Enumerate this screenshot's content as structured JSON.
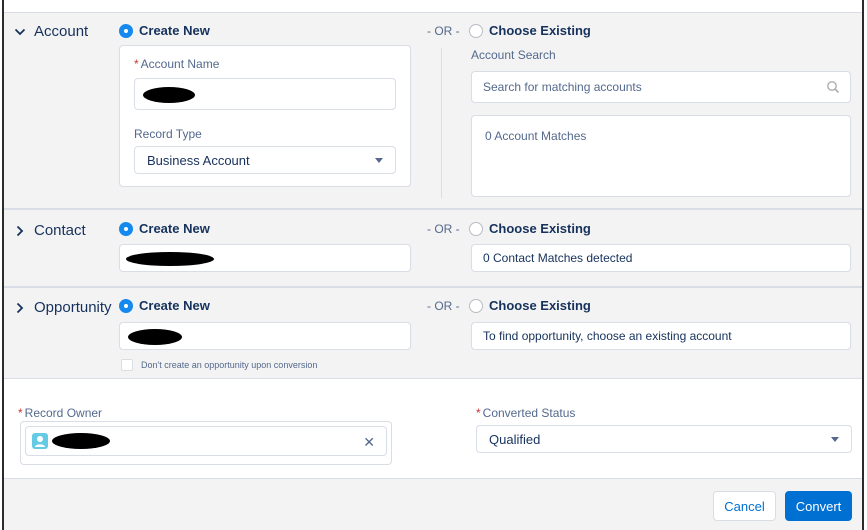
{
  "account": {
    "title": "Account",
    "create_new": "Create New",
    "or": "- OR -",
    "choose_existing": "Choose Existing",
    "account_name_label": "Account Name",
    "record_type_label": "Record Type",
    "record_type_value": "Business Account",
    "search_label": "Account Search",
    "search_placeholder": "Search for matching accounts",
    "matches": "0 Account Matches"
  },
  "contact": {
    "title": "Contact",
    "create_new": "Create New",
    "or": "- OR -",
    "choose_existing": "Choose Existing",
    "matches": "0 Contact Matches detected"
  },
  "opportunity": {
    "title": "Opportunity",
    "create_new": "Create New",
    "or": "- OR -",
    "choose_existing": "Choose Existing",
    "existing_hint": "To find opportunity, choose an existing account",
    "no_opp_checkbox_label": "Don't create an opportunity upon conversion"
  },
  "owner": {
    "record_owner_label": "Record Owner",
    "converted_status_label": "Converted Status",
    "converted_status_value": "Qualified",
    "required_mark": "*"
  },
  "footer": {
    "cancel": "Cancel",
    "convert": "Convert"
  },
  "colors": {
    "brand": "#0070d2",
    "radio_selected": "#1589ee",
    "required": "#c23934",
    "text": "#16325c",
    "muted": "#54698d"
  }
}
